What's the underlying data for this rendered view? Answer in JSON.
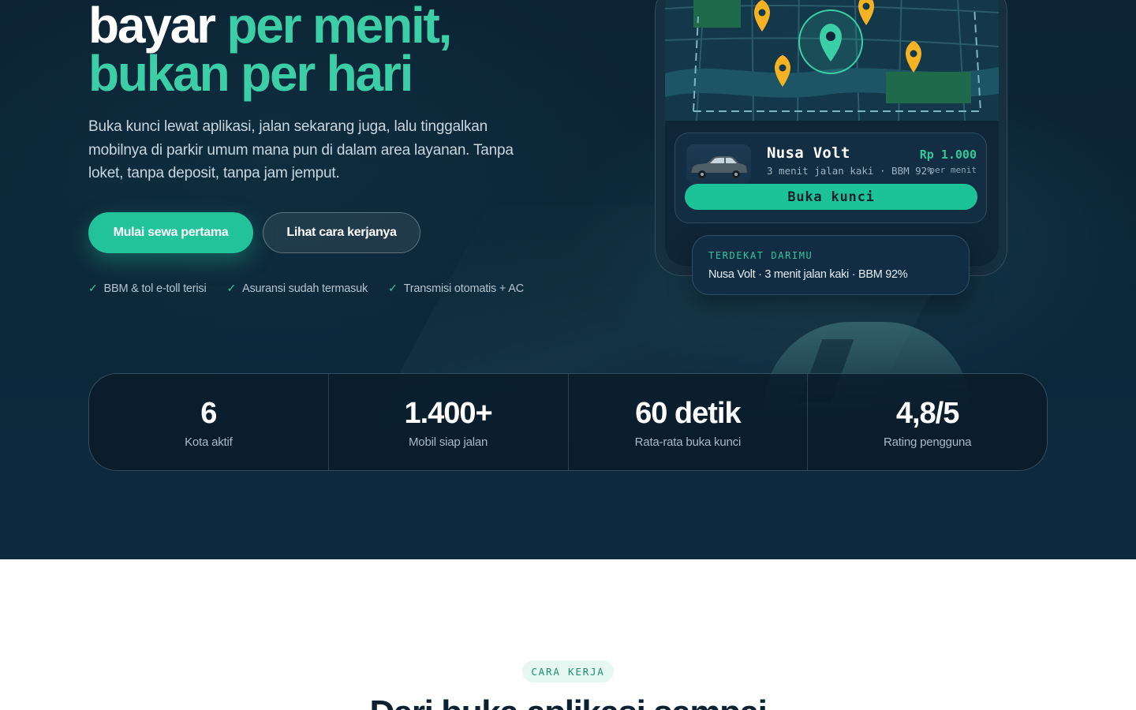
{
  "hero": {
    "headline_line1_white": "bayar",
    "headline_line1_accent": "per menit,",
    "headline_line2": "bukan per hari",
    "description": "Buka kunci lewat aplikasi, jalan sekarang juga, lalu tinggalkan mobilnya di parkir umum mana pun di dalam area layanan. Tanpa loket, tanpa deposit, tanpa jam jemput.",
    "primary_cta": "Mulai sewa pertama",
    "secondary_cta": "Lihat cara kerjanya",
    "features": [
      {
        "label": "BBM & tol e-toll terisi",
        "icon": "check-icon"
      },
      {
        "label": "Asuransi sudah termasuk",
        "icon": "check-icon"
      },
      {
        "label": "Transmisi otomatis + AC",
        "icon": "check-icon"
      }
    ]
  },
  "phone": {
    "map_pins": [
      "location-pin-icon",
      "location-pin-icon",
      "location-pin-icon",
      "location-pin-icon",
      "selected-pin-icon"
    ],
    "ride": {
      "name": "Nusa Volt",
      "meta": "3 menit jalan kaki · BBM 92%",
      "price": "Rp 1.000",
      "price_unit": "per menit",
      "unlock_label": "Buka kunci"
    },
    "nearby": {
      "label": "TERDEKAT DARIMU",
      "value": "Nusa Volt · 3 menit jalan kaki · BBM 92%"
    }
  },
  "stats": [
    {
      "value": "6",
      "label": "Kota aktif"
    },
    {
      "value": "1.400+",
      "label": "Mobil siap jalan"
    },
    {
      "value": "60 detik",
      "label": "Rata-rata buka kunci"
    },
    {
      "value": "4,8/5",
      "label": "Rating pengguna"
    }
  ],
  "how_it_works": {
    "badge": "CARA KERJA",
    "title": "Dari buka aplikasi sampai"
  },
  "colors": {
    "accent": "#3ccfa7",
    "button": "#22c39a",
    "hero_bg": "#0c2638",
    "pin": "#f5b323"
  }
}
